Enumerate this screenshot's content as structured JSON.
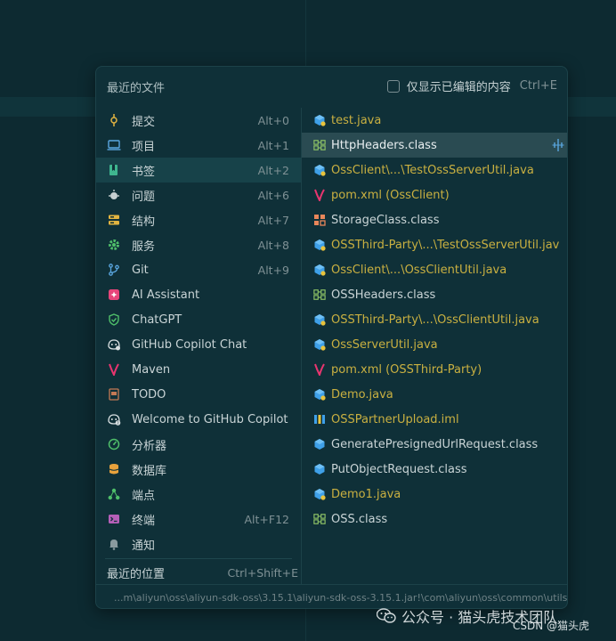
{
  "popup": {
    "title": "最近的文件",
    "filter_label": "仅显示已编辑的内容",
    "filter_shortcut": "Ctrl+E"
  },
  "nav": [
    {
      "label": "提交",
      "shortcut": "Alt+0",
      "icon": "commit-icon"
    },
    {
      "label": "项目",
      "shortcut": "Alt+1",
      "icon": "project-icon"
    },
    {
      "label": "书签",
      "shortcut": "Alt+2",
      "icon": "bookmark-icon",
      "selected": true
    },
    {
      "label": "问题",
      "shortcut": "Alt+6",
      "icon": "problems-icon"
    },
    {
      "label": "结构",
      "shortcut": "Alt+7",
      "icon": "structure-icon"
    },
    {
      "label": "服务",
      "shortcut": "Alt+8",
      "icon": "services-icon"
    },
    {
      "label": "Git",
      "shortcut": "Alt+9",
      "icon": "git-branch-icon"
    },
    {
      "label": "AI Assistant",
      "shortcut": "",
      "icon": "ai-assistant-icon"
    },
    {
      "label": "ChatGPT",
      "shortcut": "",
      "icon": "chatgpt-icon"
    },
    {
      "label": "GitHub Copilot Chat",
      "shortcut": "",
      "icon": "copilot-chat-icon"
    },
    {
      "label": "Maven",
      "shortcut": "",
      "icon": "maven-icon"
    },
    {
      "label": "TODO",
      "shortcut": "",
      "icon": "todo-icon"
    },
    {
      "label": "Welcome to GitHub Copilot",
      "shortcut": "",
      "icon": "copilot-welcome-icon"
    },
    {
      "label": "分析器",
      "shortcut": "",
      "icon": "profiler-icon"
    },
    {
      "label": "数据库",
      "shortcut": "",
      "icon": "database-icon"
    },
    {
      "label": "端点",
      "shortcut": "",
      "icon": "endpoints-icon"
    },
    {
      "label": "终端",
      "shortcut": "Alt+F12",
      "icon": "terminal-icon"
    },
    {
      "label": "通知",
      "shortcut": "",
      "icon": "notification-bell-icon"
    }
  ],
  "recent_location": {
    "label": "最近的位置",
    "shortcut": "Ctrl+Shift+E"
  },
  "files": [
    {
      "name": "test.java",
      "type": "java",
      "style": "mod"
    },
    {
      "name": "HttpHeaders.class",
      "type": "class",
      "style": "white",
      "selected": true
    },
    {
      "name": "OssClient\\...\\TestOssServerUtil.java",
      "type": "java",
      "style": "mod"
    },
    {
      "name": "pom.xml (OssClient)",
      "type": "maven",
      "style": "mod"
    },
    {
      "name": "StorageClass.class",
      "type": "enum",
      "style": "normal"
    },
    {
      "name": "OSSThird-Party\\...\\TestOssServerUtil.jav",
      "type": "java",
      "style": "mod"
    },
    {
      "name": "OssClient\\...\\OssClientUtil.java",
      "type": "java",
      "style": "mod"
    },
    {
      "name": "OSSHeaders.class",
      "type": "class",
      "style": "normal"
    },
    {
      "name": "OSSThird-Party\\...\\OssClientUtil.java",
      "type": "java",
      "style": "mod"
    },
    {
      "name": "OssServerUtil.java",
      "type": "java",
      "style": "mod"
    },
    {
      "name": "pom.xml (OSSThird-Party)",
      "type": "maven",
      "style": "mod"
    },
    {
      "name": "Demo.java",
      "type": "java",
      "style": "mod"
    },
    {
      "name": "OSSPartnerUpload.iml",
      "type": "iml",
      "style": "mod"
    },
    {
      "name": "GeneratePresignedUrlRequest.class",
      "type": "classfile",
      "style": "normal"
    },
    {
      "name": "PutObjectRequest.class",
      "type": "classfile",
      "style": "normal"
    },
    {
      "name": "Demo1.java",
      "type": "java",
      "style": "mod"
    },
    {
      "name": "OSS.class",
      "type": "class",
      "style": "normal"
    }
  ],
  "footer": {
    "path": "...m\\aliyun\\oss\\aliyun-sdk-oss\\3.15.1\\aliyun-sdk-oss-3.15.1.jar!\\com\\aliyun\\oss\\common\\utils"
  },
  "watermark": {
    "text": "公众号 · 猫头虎技术团队",
    "csdn": "CSDN @猫头虎"
  },
  "colors": {
    "background": "#0d2a31",
    "popup": "#0f3038",
    "modified_text": "#c9b041",
    "selected_row": "#2a4b52"
  }
}
